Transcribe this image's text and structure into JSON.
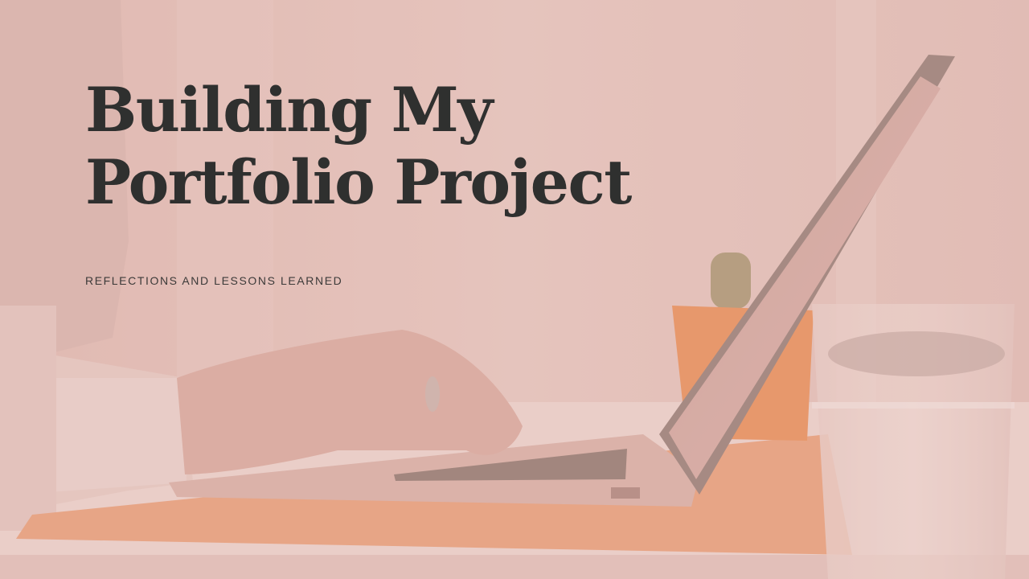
{
  "slide": {
    "title_line1": "Building My",
    "title_line2": "Portfolio Project",
    "subtitle": "REFLECTIONS AND LESSONS LEARNED"
  },
  "colors": {
    "overlay_tint": "#e3bdb6",
    "title_text": "#2f302f",
    "subtitle_text": "#3c3a39",
    "desk_mat": "#e99c74",
    "plant_pot": "#e98a4f"
  }
}
